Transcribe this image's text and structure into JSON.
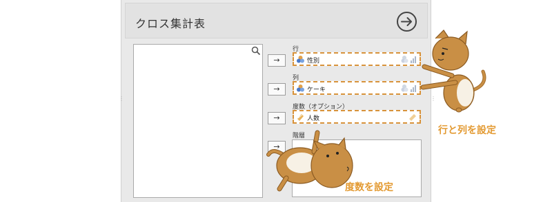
{
  "dialog": {
    "title": "クロス集計表"
  },
  "sections": {
    "row": {
      "label": "行",
      "value": "性別"
    },
    "column": {
      "label": "列",
      "value": "ケーキ"
    },
    "frequency": {
      "label": "度数（オプション）",
      "value": "人数"
    },
    "layer": {
      "label": "階層"
    }
  },
  "buttons": {
    "arrow": "→"
  },
  "annotations": {
    "rows_cols": "行と列を設定",
    "freq": "度数を設定"
  },
  "colors": {
    "accent": "#e39a32",
    "dashed_border": "#d8923a",
    "cat_body": "#c98f45"
  }
}
